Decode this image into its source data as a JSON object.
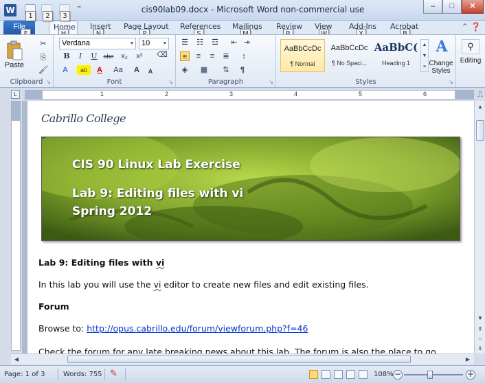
{
  "window": {
    "title": "cis90lab09.docx - Microsoft Word non-commercial use",
    "app_icon": "W",
    "minimize": "–",
    "maximize": "□",
    "close": "✕"
  },
  "keytips": {
    "qat1": "1",
    "qat2": "2",
    "qat3": "3",
    "file": "F",
    "home": "H",
    "insert": "N",
    "page_layout": "P",
    "references": "S",
    "mailings": "M",
    "review": "R",
    "view": "W",
    "addins": "X",
    "acrobat": "B"
  },
  "tabs": {
    "file": "File",
    "home": "Home",
    "insert": "Insert",
    "page_layout": "Page Layout",
    "references": "References",
    "mailings": "Mailings",
    "review": "Review",
    "view": "View",
    "addins": "Add-Ins",
    "acrobat": "Acrobat"
  },
  "ribbon": {
    "clipboard": {
      "label": "Clipboard",
      "paste": "Paste"
    },
    "font": {
      "label": "Font",
      "family": "Verdana",
      "size": "10",
      "bold": "B",
      "italic": "I",
      "underline": "U",
      "strike": "abe",
      "subscript": "x₂",
      "superscript": "x²",
      "grow": "A",
      "shrink": "A",
      "case": "Aa"
    },
    "paragraph": {
      "label": "Paragraph",
      "pilcrow": "¶"
    },
    "styles": {
      "label": "Styles",
      "items": [
        {
          "preview": "AaBbCcDc",
          "name": "¶ Normal"
        },
        {
          "preview": "AaBbCcDc",
          "name": "¶ No Spaci..."
        },
        {
          "preview": "AaBbC(",
          "name": "Heading 1"
        }
      ],
      "change_styles": "Change Styles"
    },
    "editing": {
      "label": "Editing"
    }
  },
  "ruler": {
    "numbers": [
      "1",
      "2",
      "3",
      "4",
      "5",
      "6"
    ]
  },
  "document": {
    "logo": "Cabrillo College",
    "banner": {
      "line1": "CIS 90 Linux Lab Exercise",
      "line2": "Lab 9:  Editing files with vi",
      "line3": "Spring 2012"
    },
    "heading": "Lab 9: Editing files with ",
    "heading_vi": "vi",
    "intro_pre": "In this lab you will use the ",
    "intro_vi": "vi",
    "intro_post": " editor to create  new files and edit existing files.",
    "forum_heading": "Forum",
    "browse_label": "Browse to: ",
    "forum_url": "http://opus.cabrillo.edu/forum/viewforum.php?f=46",
    "check_text": "Check the forum for any late breaking  news about this lab. The forum is also the place to go"
  },
  "status": {
    "page": "Page: 1 of 3",
    "words": "Words: 755",
    "zoom": "108%"
  },
  "colors": {
    "accent": "#2b5797",
    "file_tab": "#2459a8",
    "link": "#0033cc"
  }
}
